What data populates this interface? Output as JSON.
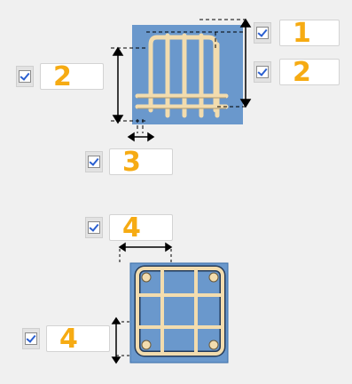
{
  "fields": {
    "top_cover": {
      "checked": true,
      "value": "1"
    },
    "left_height": {
      "checked": true,
      "value": "2"
    },
    "right_height": {
      "checked": true,
      "value": "2"
    },
    "bar_spacing": {
      "checked": true,
      "value": "3"
    },
    "stirrup_spacing": {
      "checked": true,
      "value": "4"
    },
    "side_cover": {
      "checked": true,
      "value": "4"
    }
  },
  "colors": {
    "value_text": "#f6ab13",
    "diagram_blue": "#6a98cc",
    "rebar": "#f2dcae",
    "checkmark": "#2a5fd0"
  },
  "icons": {
    "elevation": "rebar-cage-elevation-icon",
    "section": "rebar-cage-section-icon"
  }
}
